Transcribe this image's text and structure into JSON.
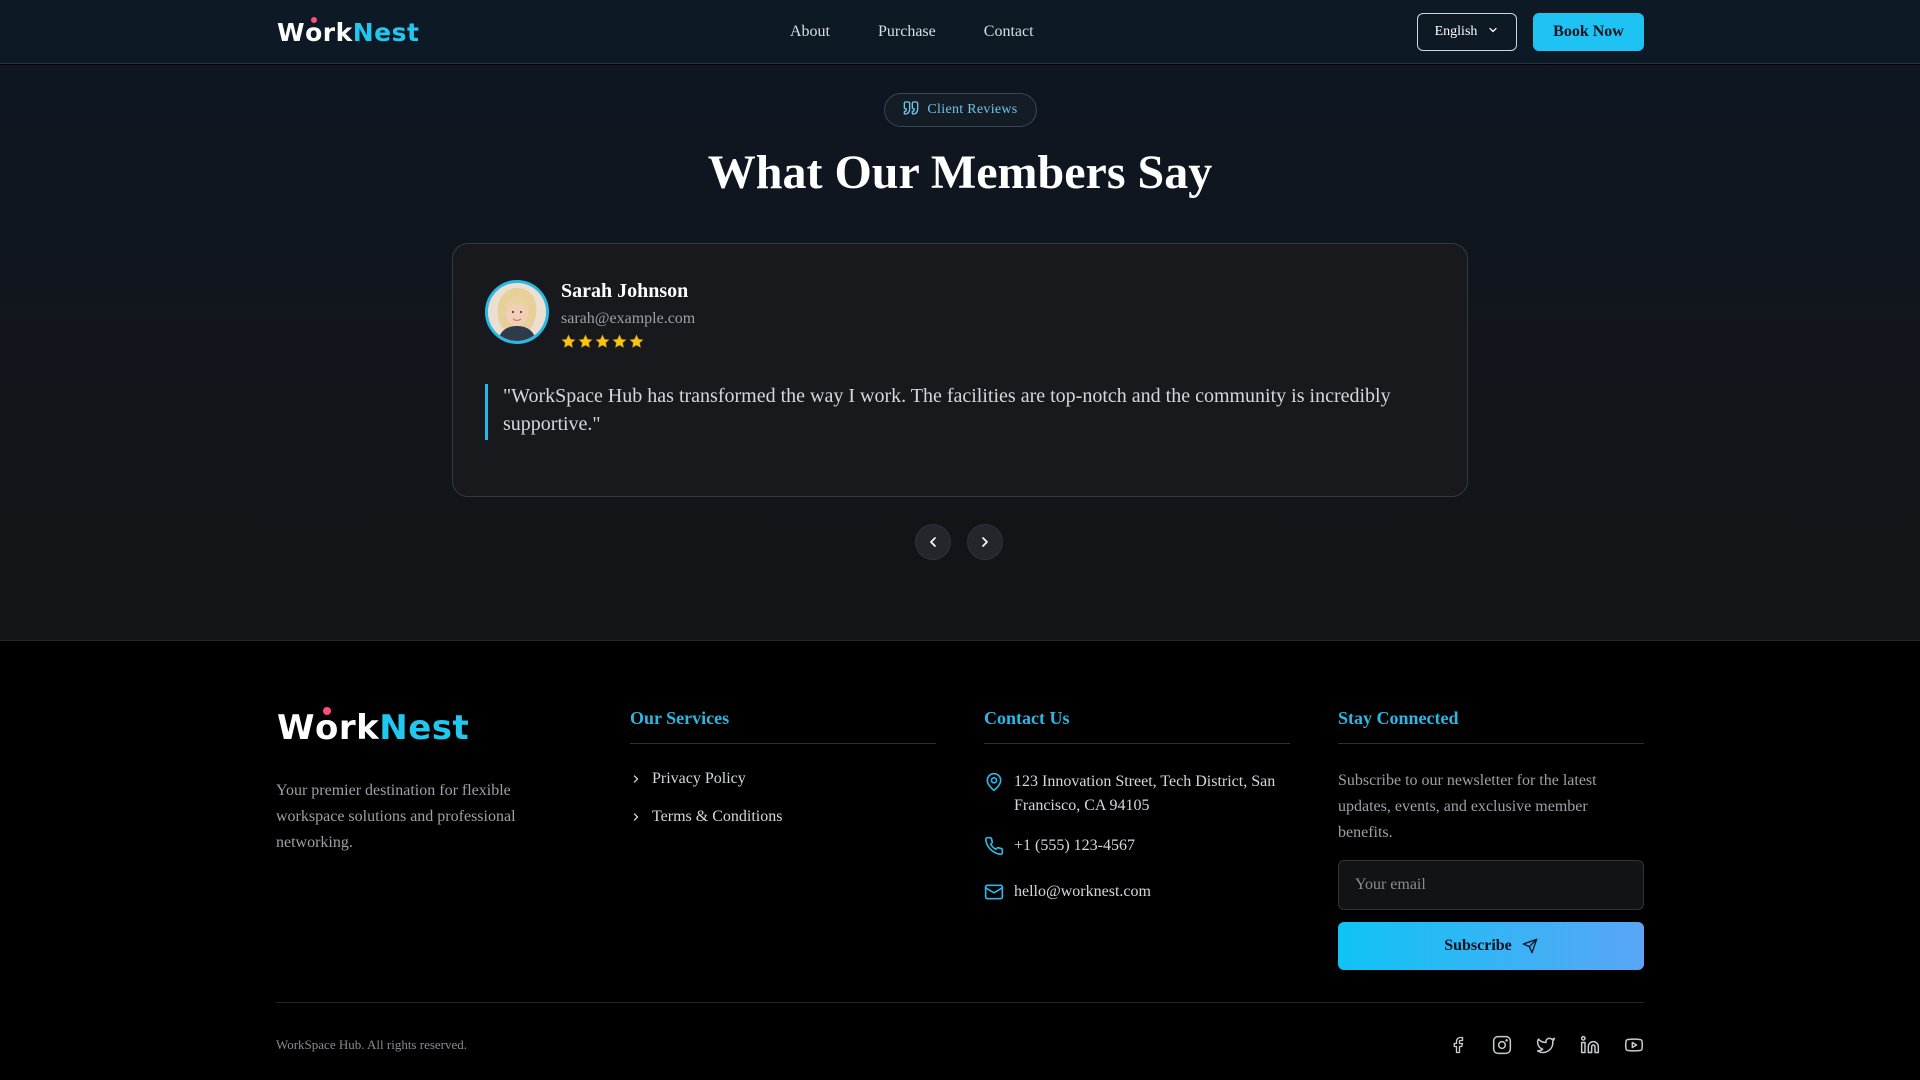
{
  "header": {
    "logo_w": "W",
    "logo_o": "o",
    "logo_rk": "rk",
    "logo_nest": "Nest",
    "nav": [
      {
        "label": "About"
      },
      {
        "label": "Purchase"
      },
      {
        "label": "Contact"
      }
    ],
    "language": "English",
    "book_label": "Book Now"
  },
  "reviews": {
    "badge": "Client Reviews",
    "title": "What Our Members Say",
    "active": {
      "name": "Sarah Johnson",
      "email": "sarah@example.com",
      "rating": 5,
      "quote": "\"WorkSpace Hub has transformed the way I work. The facilities are top-notch and the community is incredibly supportive.\""
    }
  },
  "footer": {
    "description": "Your premier destination for flexible workspace solutions and professional networking.",
    "services": {
      "heading": "Our Services",
      "items": [
        {
          "label": "Privacy Policy"
        },
        {
          "label": "Terms & Conditions"
        }
      ]
    },
    "contact": {
      "heading": "Contact Us",
      "address": "123 Innovation Street, Tech District, San Francisco, CA 94105",
      "phone": "+1 (555) 123-4567",
      "email": "hello@worknest.com"
    },
    "connect": {
      "heading": "Stay Connected",
      "text": "Subscribe to our newsletter for the latest updates, events, and exclusive member benefits.",
      "email_placeholder": "Your email",
      "subscribe_label": "Subscribe"
    },
    "copyright": "WorkSpace Hub. All rights reserved.",
    "socials": [
      "facebook-icon",
      "instagram-icon",
      "twitter-icon",
      "linkedin-icon",
      "youtube-icon"
    ]
  },
  "colors": {
    "accent": "#22c7f0",
    "star": "#f5c518",
    "logo_dot": "#ff4d7a"
  }
}
